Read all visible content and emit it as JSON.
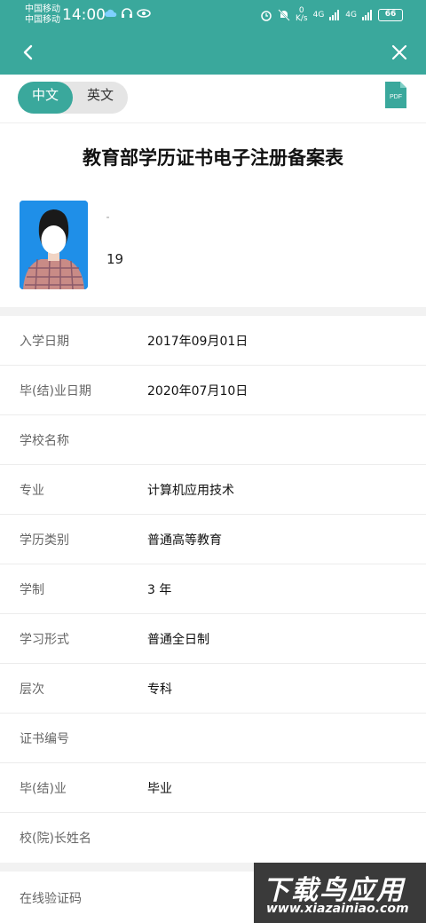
{
  "status_bar": {
    "carrier_1": "中国移动",
    "carrier_2": "中国移动",
    "time": "14:00",
    "speed_value": "0",
    "speed_unit": "K/s",
    "signal_1": "4G",
    "signal_2": "4G",
    "battery": "66"
  },
  "header": {
    "back_icon": "chevron-left-icon",
    "close_icon": "close-icon",
    "bg_color": "#3aa89c"
  },
  "lang": {
    "zh": "中文",
    "en": "英文",
    "active": "中文"
  },
  "pdf_label": "PDF",
  "title": "教育部学历证书电子注册备案表",
  "profile": {
    "id_partial": "19"
  },
  "rows": [
    {
      "label": "入学日期",
      "value": "2017年09月01日"
    },
    {
      "label": "毕(结)业日期",
      "value": "2020年07月10日"
    },
    {
      "label": "学校名称",
      "value": ""
    },
    {
      "label": "专业",
      "value": "计算机应用技术"
    },
    {
      "label": "学历类别",
      "value": "普通高等教育"
    },
    {
      "label": "学制",
      "value": "3 年"
    },
    {
      "label": "学习形式",
      "value": "普通全日制"
    },
    {
      "label": "层次",
      "value": "专科"
    },
    {
      "label": "证书编号",
      "value": ""
    },
    {
      "label": "毕(结)业",
      "value": "毕业"
    },
    {
      "label": "校(院)长姓名",
      "value": ""
    }
  ],
  "verify_row": {
    "label": "在线验证码",
    "value": ""
  },
  "watermark": {
    "big": "下载鸟应用",
    "small": "www.xiazainiao.com"
  }
}
